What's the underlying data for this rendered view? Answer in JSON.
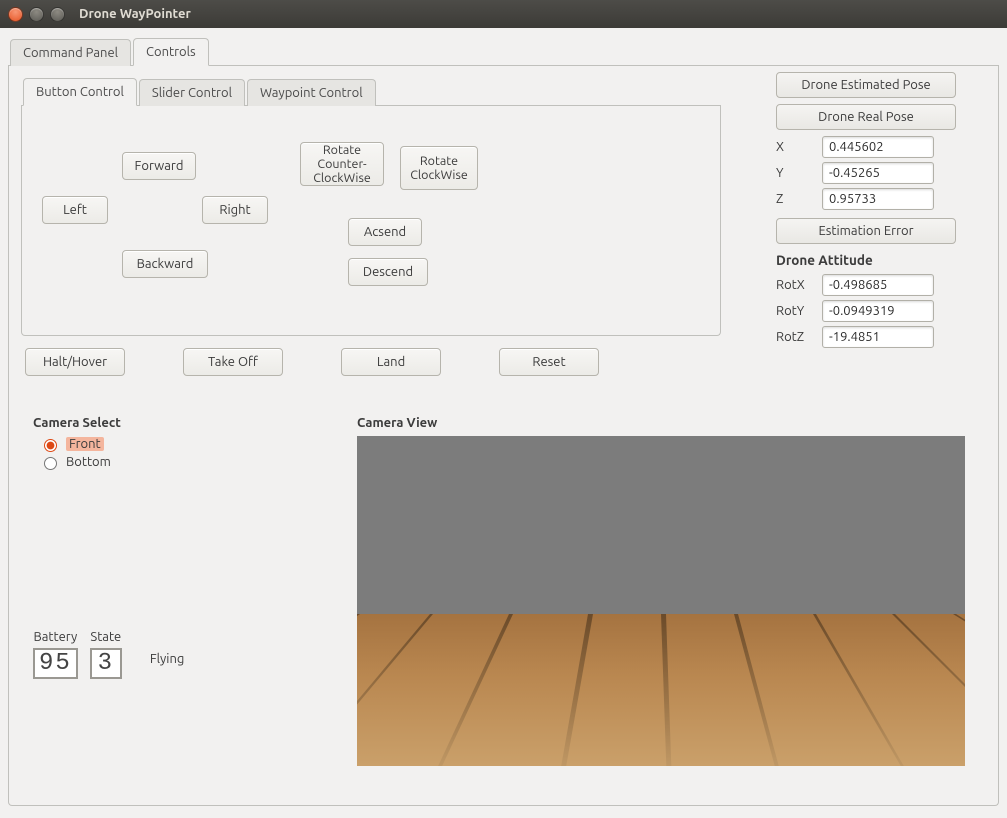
{
  "window": {
    "title": "Drone WayPointer"
  },
  "top_tabs": {
    "command_panel": "Command Panel",
    "controls": "Controls"
  },
  "nested_tabs": {
    "button": "Button Control",
    "slider": "Slider Control",
    "waypoint": "Waypoint Control"
  },
  "buttons": {
    "forward": "Forward",
    "backward": "Backward",
    "left": "Left",
    "right": "Right",
    "rot_ccw": "Rotate\nCounter-\nClockWise",
    "rot_cw": "Rotate\nClockWise",
    "ascend": "Acsend",
    "descend": "Descend",
    "halt": "Halt/Hover",
    "takeoff": "Take Off",
    "land": "Land",
    "reset": "Reset"
  },
  "right": {
    "est_pose_btn": "Drone Estimated Pose",
    "real_pose_btn": "Drone Real Pose",
    "est_err_btn": "Estimation Error",
    "attitude_hdr": "Drone Attitude",
    "labels": {
      "x": "X",
      "y": "Y",
      "z": "Z",
      "rotx": "RotX",
      "roty": "RotY",
      "rotz": "RotZ"
    },
    "values": {
      "x": "0.445602",
      "y": "-0.45265",
      "z": "0.95733",
      "rotx": "-0.498685",
      "roty": "-0.0949319",
      "rotz": "-19.4851"
    }
  },
  "camera": {
    "title": "Camera Select",
    "front_label": "Front",
    "bottom_label": "Bottom",
    "view_label": "Camera View"
  },
  "status": {
    "battery_label": "Battery",
    "state_label": "State",
    "battery_value": "95",
    "state_value": "3",
    "state_text": "Flying"
  }
}
